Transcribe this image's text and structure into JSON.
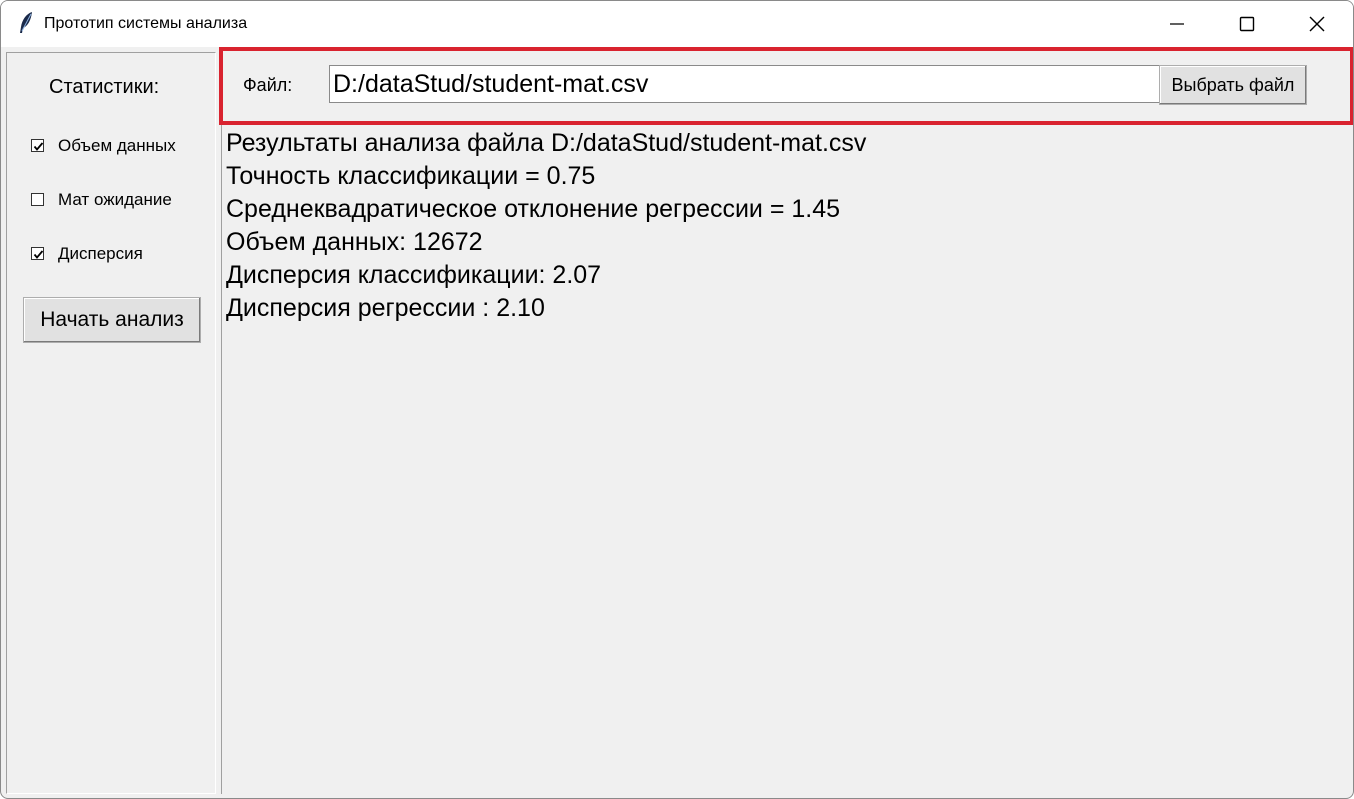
{
  "window": {
    "title": "Прототип системы анализа"
  },
  "sidebar": {
    "heading": "Статистики:",
    "checkboxes": [
      {
        "label": "Объем данных",
        "checked": true
      },
      {
        "label": "Мат ожидание",
        "checked": false
      },
      {
        "label": "Дисперсия",
        "checked": true
      }
    ],
    "start_button": "Начать анализ"
  },
  "file": {
    "label": "Файл:",
    "path": "D:/dataStud/student-mat.csv",
    "choose_button": "Выбрать файл"
  },
  "results": [
    "Результаты анализа файла D:/dataStud/student-mat.csv",
    "Точность классификации = 0.75",
    "Среднеквадратическое отклонение регрессии = 1.45",
    "Объем данных: 12672",
    "Дисперсия классификации: 2.07",
    "Дисперсия регрессии : 2.10"
  ],
  "colors": {
    "highlight_border": "#d9232f"
  }
}
